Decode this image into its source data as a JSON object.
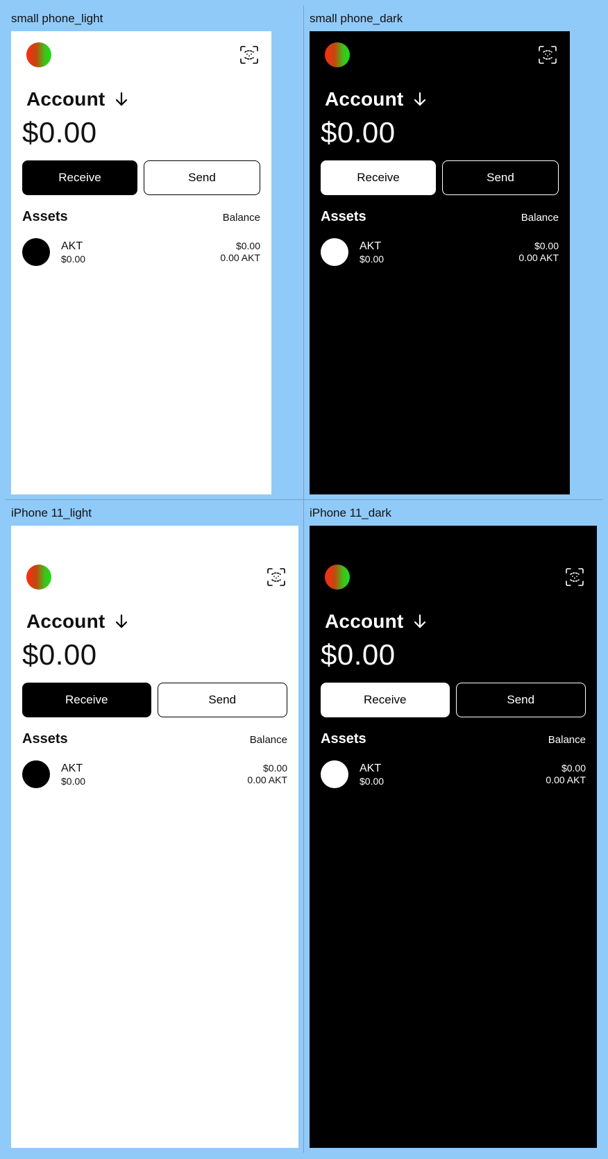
{
  "frames": [
    {
      "label": "small phone_light",
      "account_title": "Account",
      "balance": "$0.00",
      "receive_label": "Receive",
      "send_label": "Send",
      "assets_title": "Assets",
      "balance_header": "Balance",
      "asset": {
        "name": "AKT",
        "usd_value": "$0.00",
        "amount_usd": "$0.00",
        "amount_token": "0.00 AKT"
      }
    },
    {
      "label": "small phone_dark",
      "account_title": "Account",
      "balance": "$0.00",
      "receive_label": "Receive",
      "send_label": "Send",
      "assets_title": "Assets",
      "balance_header": "Balance",
      "asset": {
        "name": "AKT",
        "usd_value": "$0.00",
        "amount_usd": "$0.00",
        "amount_token": "0.00 AKT"
      }
    },
    {
      "label": "iPhone 11_light",
      "account_title": "Account",
      "balance": "$0.00",
      "receive_label": "Receive",
      "send_label": "Send",
      "assets_title": "Assets",
      "balance_header": "Balance",
      "asset": {
        "name": "AKT",
        "usd_value": "$0.00",
        "amount_usd": "$0.00",
        "amount_token": "0.00 AKT"
      }
    },
    {
      "label": "iPhone 11_dark",
      "account_title": "Account",
      "balance": "$0.00",
      "receive_label": "Receive",
      "send_label": "Send",
      "assets_title": "Assets",
      "balance_header": "Balance",
      "asset": {
        "name": "AKT",
        "usd_value": "$0.00",
        "amount_usd": "$0.00",
        "amount_token": "0.00 AKT"
      }
    }
  ],
  "colors": {
    "canvas_bg": "#90CAF9",
    "light_bg": "#FFFFFF",
    "dark_bg": "#000000",
    "avatar_gradient": [
      "#FF2A12",
      "#18E01A"
    ]
  },
  "icons": {
    "avatar": "gradient-avatar",
    "scan": "qr-scan-icon",
    "arrow": "arrow-down-icon"
  }
}
